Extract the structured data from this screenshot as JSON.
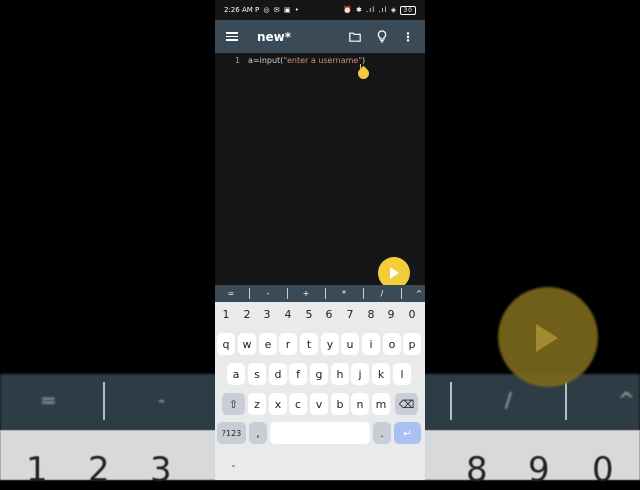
{
  "status": {
    "time": "2:26 AM",
    "left_icons": "P ◎ ✉ ▣ •",
    "right_icons": "⏰ ✱ .ıl .ıl ◈",
    "battery": "30"
  },
  "toolbar": {
    "title": "new*"
  },
  "editor": {
    "line_number": "1",
    "code_prefix": "a=input(",
    "code_string": "\"enter a username\"",
    "code_suffix": ")"
  },
  "symbols": [
    "=",
    "-",
    "+",
    "*",
    "/",
    "^"
  ],
  "keyboard": {
    "numbers": [
      "1",
      "2",
      "3",
      "4",
      "5",
      "6",
      "7",
      "8",
      "9",
      "0"
    ],
    "row1": [
      "q",
      "w",
      "e",
      "r",
      "t",
      "y",
      "u",
      "i",
      "o",
      "p"
    ],
    "row2": [
      "a",
      "s",
      "d",
      "f",
      "g",
      "h",
      "j",
      "k",
      "l"
    ],
    "row3": [
      "z",
      "x",
      "c",
      "v",
      "b",
      "n",
      "m"
    ],
    "shift": "⇧",
    "backspace": "⌫",
    "symbols_key": "?123",
    "comma": ",",
    "period": ".",
    "enter": "↵",
    "hide": "⌄"
  },
  "background": {
    "symbols": [
      "=",
      "-",
      "/",
      "^"
    ],
    "digits": [
      "1",
      "2",
      "3",
      "8",
      "9",
      "0"
    ]
  },
  "colors": {
    "toolbar": "#3a4b57",
    "accent": "#f3cc3a",
    "enter_key": "#a9c1f0"
  }
}
